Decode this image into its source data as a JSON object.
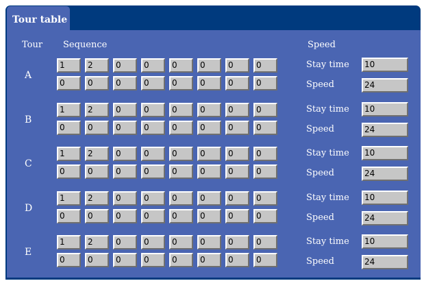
{
  "tab_title": "Tour table",
  "headers": {
    "tour": "Tour",
    "sequence": "Sequence",
    "speed": "Speed"
  },
  "labels": {
    "stay_time": "Stay time",
    "speed": "Speed"
  },
  "tours": [
    {
      "letter": "A",
      "seq_row1": [
        "1",
        "2",
        "0",
        "0",
        "0",
        "0",
        "0",
        "0"
      ],
      "seq_row2": [
        "0",
        "0",
        "0",
        "0",
        "0",
        "0",
        "0",
        "0"
      ],
      "stay_time": "10",
      "speed": "24"
    },
    {
      "letter": "B",
      "seq_row1": [
        "1",
        "2",
        "0",
        "0",
        "0",
        "0",
        "0",
        "0"
      ],
      "seq_row2": [
        "0",
        "0",
        "0",
        "0",
        "0",
        "0",
        "0",
        "0"
      ],
      "stay_time": "10",
      "speed": "24"
    },
    {
      "letter": "C",
      "seq_row1": [
        "1",
        "2",
        "0",
        "0",
        "0",
        "0",
        "0",
        "0"
      ],
      "seq_row2": [
        "0",
        "0",
        "0",
        "0",
        "0",
        "0",
        "0",
        "0"
      ],
      "stay_time": "10",
      "speed": "24"
    },
    {
      "letter": "D",
      "seq_row1": [
        "1",
        "2",
        "0",
        "0",
        "0",
        "0",
        "0",
        "0"
      ],
      "seq_row2": [
        "0",
        "0",
        "0",
        "0",
        "0",
        "0",
        "0",
        "0"
      ],
      "stay_time": "10",
      "speed": "24"
    },
    {
      "letter": "E",
      "seq_row1": [
        "1",
        "2",
        "0",
        "0",
        "0",
        "0",
        "0",
        "0"
      ],
      "seq_row2": [
        "0",
        "0",
        "0",
        "0",
        "0",
        "0",
        "0",
        "0"
      ],
      "stay_time": "10",
      "speed": "24"
    }
  ]
}
